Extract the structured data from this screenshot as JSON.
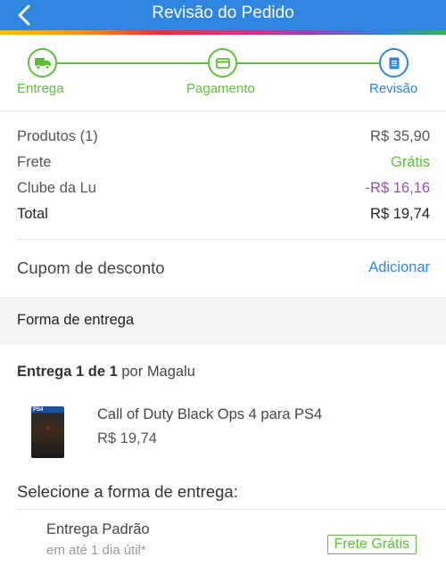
{
  "header": {
    "title": "Revisão do Pedido",
    "back_icon": "chevron-left-icon",
    "background": "#2f86e0"
  },
  "stepper": {
    "steps": [
      {
        "label": "Entrega",
        "icon": "truck-icon",
        "state": "done"
      },
      {
        "label": "Pagamento",
        "icon": "card-icon",
        "state": "done"
      },
      {
        "label": "Revisão",
        "icon": "document-icon",
        "state": "active"
      }
    ],
    "colors": {
      "done": "#5bc236",
      "active": "#2f86e0"
    }
  },
  "summary": {
    "rows": [
      {
        "label": "Produtos (1)",
        "value": "R$ 35,90",
        "color": "#555555"
      },
      {
        "label": "Frete",
        "value": "Grátis",
        "color": "#5bc236"
      },
      {
        "label": "Clube da Lu",
        "value": "-R$ 16,16",
        "color": "#a04aa8"
      },
      {
        "label": "Total",
        "value": "R$ 19,74",
        "color": "#222222"
      }
    ]
  },
  "coupon": {
    "label": "Cupom de desconto",
    "action": "Adicionar"
  },
  "delivery_section": {
    "title": "Forma de entrega",
    "shipment_bold": "Entrega 1 de 1",
    "shipment_rest": " por Magalu",
    "product": {
      "name": "Call of Duty Black Ops 4 para PS4",
      "price": "R$ 19,74",
      "image_icon": "game-cover-icon"
    },
    "select_title": "Selecione a forma de entrega:",
    "option": {
      "name": "Entrega Padrão",
      "eta": "em até 1 dia útil*",
      "badge": "Frete Grátis"
    }
  }
}
